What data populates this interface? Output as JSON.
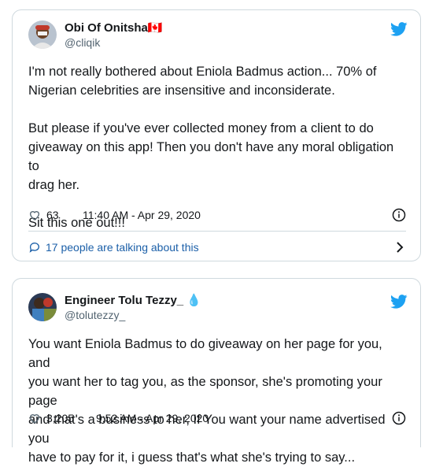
{
  "tweets": [
    {
      "display_name": "Obi Of Onitsha🇨🇦",
      "handle": "@cliqik",
      "text": "I'm not really bothered about Eniola Badmus action... 70% of\nNigerian celebrities are insensitive and inconsiderate.\n\nBut please if you've ever collected money from a client to do\ngiveaway on this app! Then you don't have any moral obligation to\ndrag her.\n\nSit this one out!!!",
      "likes": "63",
      "timestamp": "11:40 AM - Apr 29, 2020",
      "conversation": "17 people are talking about this"
    },
    {
      "display_name": "Engineer Tolu Tezzy_ 💧",
      "handle": "@tolutezzy_",
      "text": "You want Eniola Badmus to do giveaway on her page for you, and\nyou want her to tag you, as the sponsor, she's promoting your page\nand that's a business to her, If You want your name advertised you\nhave to pay for it, i guess that's what she's trying to say...",
      "likes": "3,205",
      "timestamp": "9:52 AM - Apr 29, 2020"
    }
  ],
  "colors": {
    "brand": "#1da1f2",
    "link": "#1b5fa8",
    "border": "#cfd9de"
  },
  "icons": [
    "twitter-bird-icon",
    "heart-icon",
    "info-icon",
    "speech-bubble-icon",
    "chevron-right-icon"
  ]
}
